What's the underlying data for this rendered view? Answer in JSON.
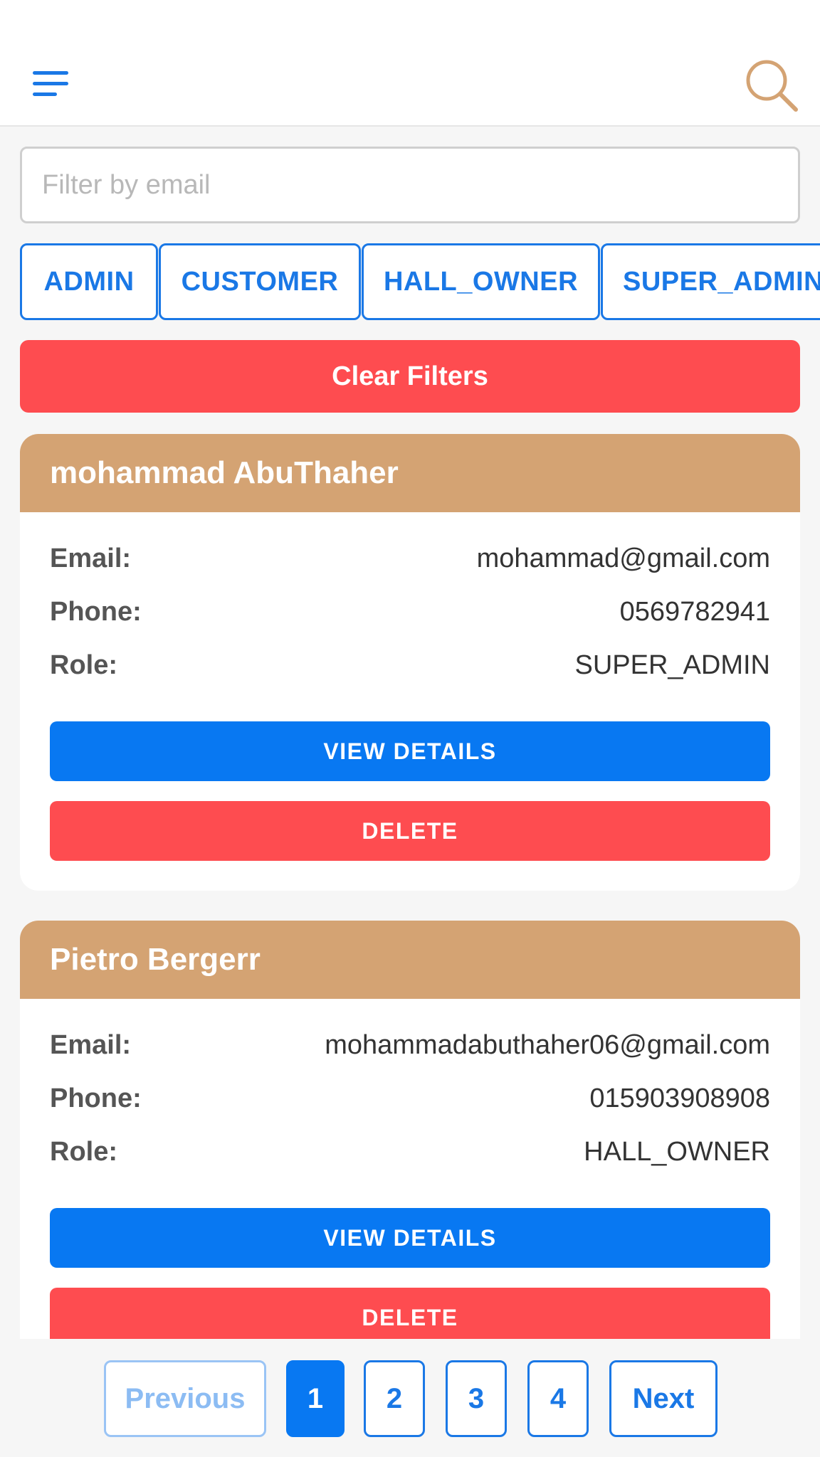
{
  "header": {
    "menu_icon": "hamburger-menu-icon",
    "search_icon": "search-icon",
    "colors": {
      "menu": "#1a78e6",
      "search": "#d4a373"
    }
  },
  "filter": {
    "placeholder": "Filter by email",
    "value": ""
  },
  "role_filters": [
    "ADMIN",
    "CUSTOMER",
    "HALL_OWNER",
    "SUPER_ADMIN"
  ],
  "clear_filters_label": "Clear Filters",
  "labels": {
    "email": "Email:",
    "phone": "Phone:",
    "role": "Role:"
  },
  "users": [
    {
      "name": "mohammad AbuThaher",
      "email": "mohammad@gmail.com",
      "phone": "0569782941",
      "role": "SUPER_ADMIN",
      "view_label": "VIEW DETAILS",
      "delete_label": "DELETE"
    },
    {
      "name": "Pietro Bergerr",
      "email": "mohammadabuthaher06@gmail.com",
      "phone": "015903908908",
      "role": "HALL_OWNER",
      "view_label": "VIEW DETAILS",
      "delete_label": "DELETE"
    }
  ],
  "pagination": {
    "previous": "Previous",
    "pages": [
      "1",
      "2",
      "3",
      "4"
    ],
    "current": "1",
    "next": "Next"
  },
  "colors": {
    "primary": "#0878f2",
    "danger": "#fe4c50",
    "card_header": "#d4a373"
  }
}
